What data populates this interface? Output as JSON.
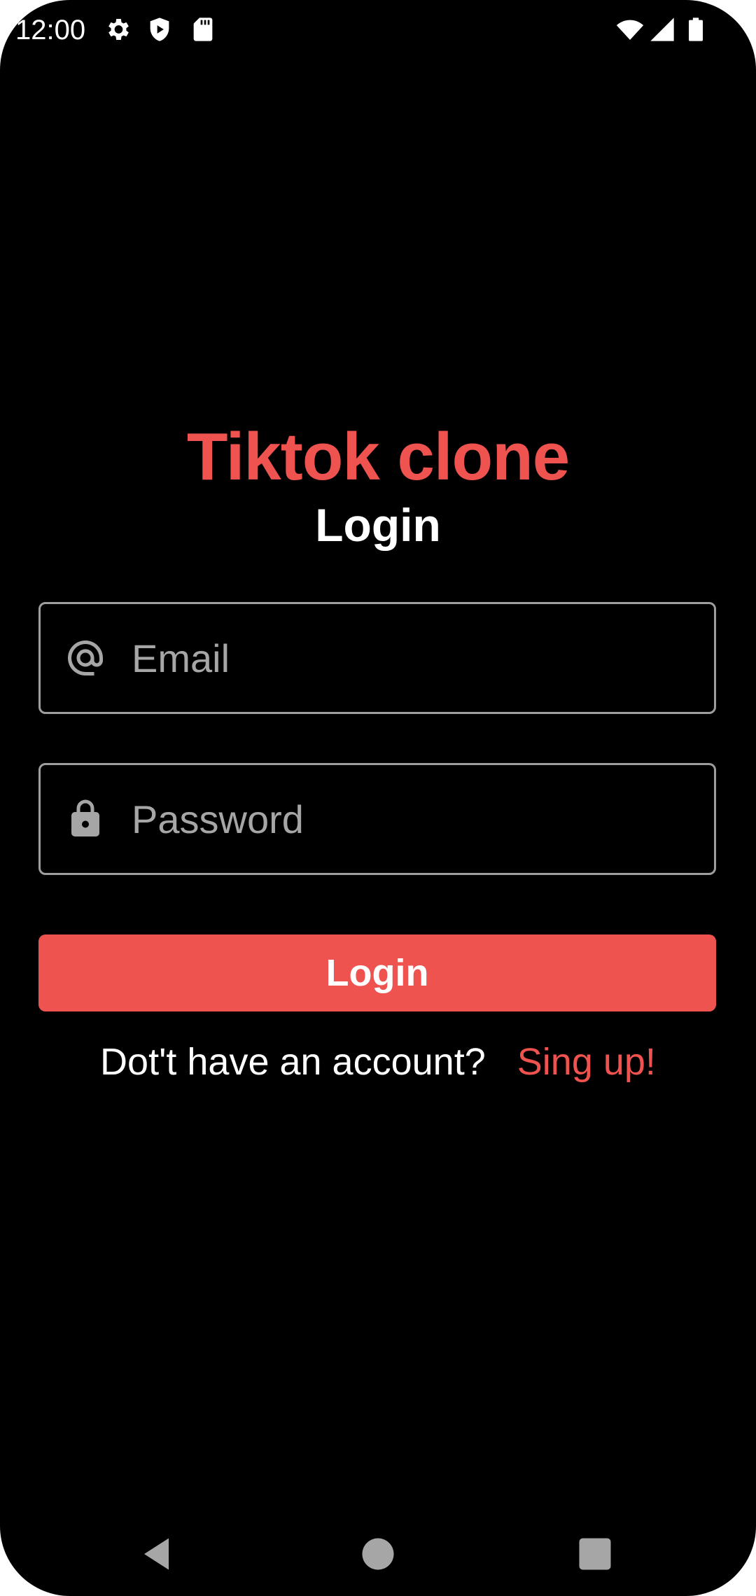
{
  "status_bar": {
    "time": "12:00",
    "left_icons": [
      "gear-icon",
      "shield-play-icon",
      "sd-card-icon"
    ],
    "right_icons": [
      "wifi-icon",
      "cell-signal-icon",
      "battery-icon"
    ]
  },
  "header": {
    "app_title": "Tiktok clone",
    "screen_title": "Login"
  },
  "form": {
    "email": {
      "placeholder": "Email",
      "value": "",
      "icon": "at-sign-icon"
    },
    "password": {
      "placeholder": "Password",
      "value": "",
      "icon": "lock-icon"
    },
    "login_label": "Login"
  },
  "signup": {
    "prompt": "Dot't have an account?",
    "link_label": "Sing up!"
  },
  "navigation": {
    "buttons": [
      "back-icon",
      "home-icon",
      "recents-icon"
    ]
  },
  "colors": {
    "accent": "#ef5350",
    "background": "#000000",
    "text": "#ffffff",
    "field_border": "#9e9e9e",
    "placeholder": "#a6a6a6"
  }
}
